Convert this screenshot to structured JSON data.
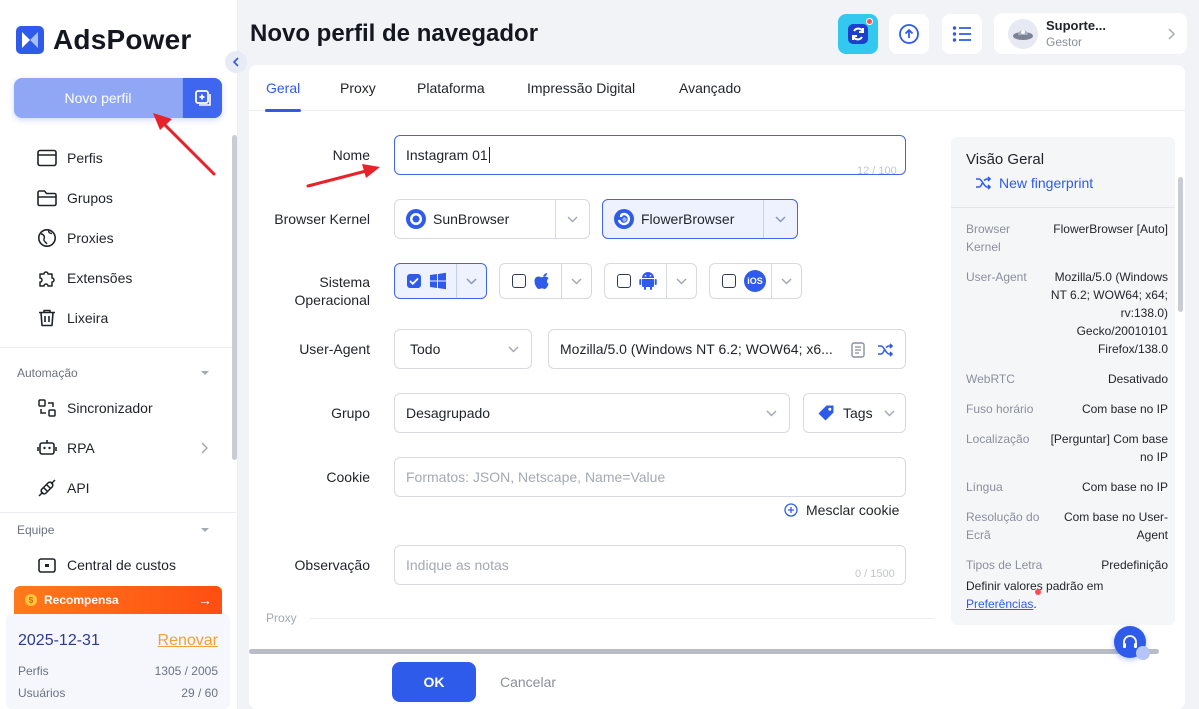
{
  "app": {
    "brand": "AdsPower"
  },
  "sidebar": {
    "new_profile_label": "Novo perfil",
    "nav": [
      {
        "label": "Perfis",
        "icon": "window-icon"
      },
      {
        "label": "Grupos",
        "icon": "folder-icon"
      },
      {
        "label": "Proxies",
        "icon": "globe-icon"
      },
      {
        "label": "Extensões",
        "icon": "puzzle-icon"
      },
      {
        "label": "Lixeira",
        "icon": "trash-icon"
      }
    ],
    "automation_section": "Automação",
    "automation": [
      {
        "label": "Sincronizador",
        "icon": "sync-icon"
      },
      {
        "label": "RPA",
        "icon": "robot-icon"
      },
      {
        "label": "API",
        "icon": "plug-icon"
      }
    ],
    "team_section": "Equipe",
    "team": [
      {
        "label": "Central de custos",
        "icon": "wallet-icon"
      }
    ],
    "reward_label": "Recompensa",
    "plan": {
      "expiry": "2025-12-31",
      "renew_label": "Renovar",
      "profiles_label": "Perfis",
      "profiles_value": "1305 / 2005",
      "users_label": "Usuários",
      "users_value": "29 / 60"
    }
  },
  "header": {
    "title": "Novo perfil de navegador",
    "user_name": "Suporte...",
    "user_role": "Gestor"
  },
  "tabs": [
    {
      "label": "Geral",
      "active": true
    },
    {
      "label": "Proxy",
      "active": false
    },
    {
      "label": "Plataforma",
      "active": false
    },
    {
      "label": "Impressão Digital",
      "active": false
    },
    {
      "label": "Avançado",
      "active": false
    }
  ],
  "form": {
    "name_label": "Nome",
    "name_value": "Instagram 01",
    "name_counter": "12 / 100",
    "kernel_label": "Browser Kernel",
    "kernel_options": [
      "SunBrowser",
      "FlowerBrowser"
    ],
    "kernel_selected": "FlowerBrowser",
    "os_label": "Sistema Operacional",
    "os_options": [
      {
        "name": "Windows",
        "checked": true
      },
      {
        "name": "macOS",
        "checked": false
      },
      {
        "name": "Android",
        "checked": false
      },
      {
        "name": "iOS",
        "checked": false
      }
    ],
    "ios_badge": "iOS",
    "ua_label": "User-Agent",
    "ua_filter": "Todo",
    "ua_value": "Mozilla/5.0 (Windows NT 6.2; WOW64; x6...",
    "group_label": "Grupo",
    "group_value": "Desagrupado",
    "tags_label": "Tags",
    "cookie_label": "Cookie",
    "cookie_placeholder": "Formatos: JSON, Netscape, Name=Value",
    "merge_cookie_label": "Mesclar cookie",
    "notes_label": "Observação",
    "notes_placeholder": "Indique as notas",
    "notes_counter": "0 / 1500",
    "proxy_section": "Proxy"
  },
  "overview": {
    "title": "Visão Geral",
    "new_fingerprint": "New fingerprint",
    "rows": [
      {
        "key": "Browser Kernel",
        "value": "FlowerBrowser [Auto]"
      },
      {
        "key": "User-Agent",
        "value": "Mozilla/5.0 (Windows NT 6.2; WOW64; x64; rv:138.0) Gecko/20010101 Firefox/138.0"
      },
      {
        "key": "WebRTC",
        "value": "Desativado"
      },
      {
        "key": "Fuso horário",
        "value": "Com base no IP"
      },
      {
        "key": "Localização",
        "value": "[Perguntar] Com base no IP"
      },
      {
        "key": "Língua",
        "value": "Com base no IP"
      },
      {
        "key": "Resolução do Ecrã",
        "value": "Com base no User-Agent"
      },
      {
        "key": "Tipos de Letra",
        "value": "Predefinição"
      }
    ],
    "footer_text": "Definir valores padrão em",
    "footer_link": "Preferências",
    "footer_end": "."
  },
  "actions": {
    "ok_label": "OK",
    "cancel_label": "Cancelar"
  },
  "colors": {
    "primary": "#2f5bea",
    "new_profile_bg": "#8fa7f5",
    "reward": "#ff5a14",
    "annotation": "#e8222a"
  }
}
